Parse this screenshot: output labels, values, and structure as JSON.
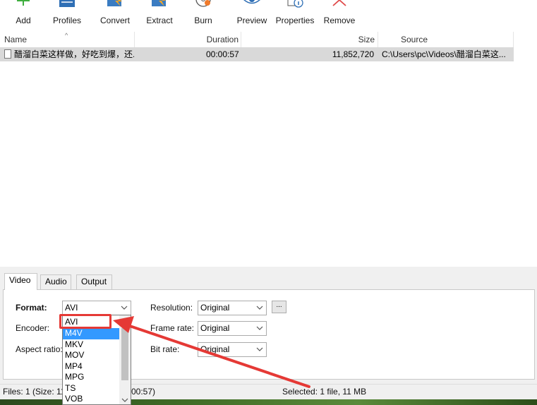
{
  "toolbar": {
    "add": "Add",
    "profiles": "Profiles",
    "convert": "Convert",
    "extract": "Extract",
    "burn": "Burn",
    "preview": "Preview",
    "properties": "Properties",
    "remove": "Remove"
  },
  "list": {
    "columns": {
      "name": "Name",
      "duration": "Duration",
      "size": "Size",
      "source": "Source"
    },
    "rows": [
      {
        "name": "醋溜白菜这样做，好吃到爆，还...",
        "duration": "00:00:57",
        "size": "11,852,720",
        "source": "C:\\Users\\pc\\Videos\\醋溜白菜这..."
      }
    ]
  },
  "tabs": [
    "Video",
    "Audio",
    "Output"
  ],
  "video_settings": {
    "format_label": "Format:",
    "format_value": "AVI",
    "encoder_label": "Encoder:",
    "aspect_label": "Aspect ratio:",
    "resolution_label": "Resolution:",
    "resolution_value": "Original",
    "dots_label": "...",
    "framerate_label": "Frame rate:",
    "framerate_value": "Original",
    "bitrate_label": "Bit rate:",
    "bitrate_value": "Original"
  },
  "format_options": [
    "AVI",
    "M4V",
    "MKV",
    "MOV",
    "MP4",
    "MPG",
    "TS",
    "VOB"
  ],
  "format_selected_index": 1,
  "status": {
    "files": "Files: 1 (Size: 11",
    "duration_tail": "00:57)",
    "selected": "Selected: 1 file, 11 MB"
  },
  "colors": {
    "accent_selected": "#3399ff",
    "annotation_red": "#e53935",
    "row_bg": "#d9d9d9"
  }
}
